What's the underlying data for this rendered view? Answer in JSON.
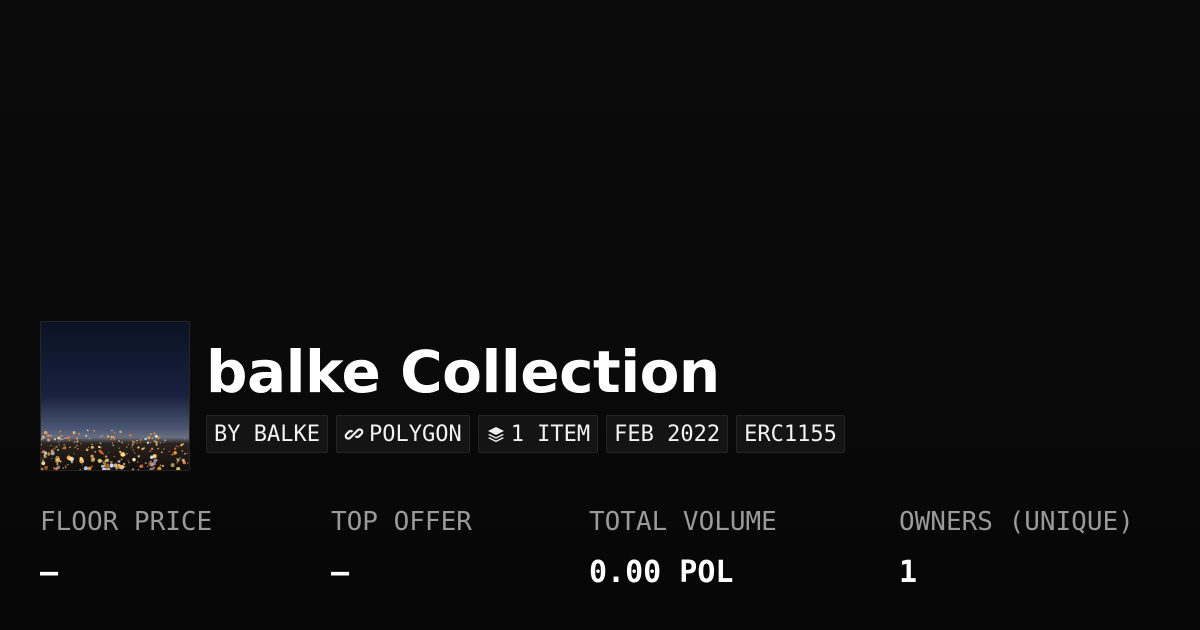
{
  "collection": {
    "title": "balke Collection",
    "thumbnail_alt": "city lights at night",
    "tags": [
      {
        "label": "BY BALKE",
        "icon": ""
      },
      {
        "label": "POLYGON",
        "icon": "chain-link-icon"
      },
      {
        "label": "1 ITEM",
        "icon": "layers-icon"
      },
      {
        "label": "FEB 2022",
        "icon": ""
      },
      {
        "label": "ERC1155",
        "icon": ""
      }
    ]
  },
  "stats": [
    {
      "label": "FLOOR PRICE",
      "value": "–"
    },
    {
      "label": "TOP OFFER",
      "value": "–"
    },
    {
      "label": "TOTAL VOLUME",
      "value": "0.00 POL"
    },
    {
      "label": "OWNERS (UNIQUE)",
      "value": "1"
    }
  ],
  "colors": {
    "background": "#070707",
    "tag_background": "#141414",
    "label_gray": "#9a9a9a",
    "text": "#ffffff"
  }
}
